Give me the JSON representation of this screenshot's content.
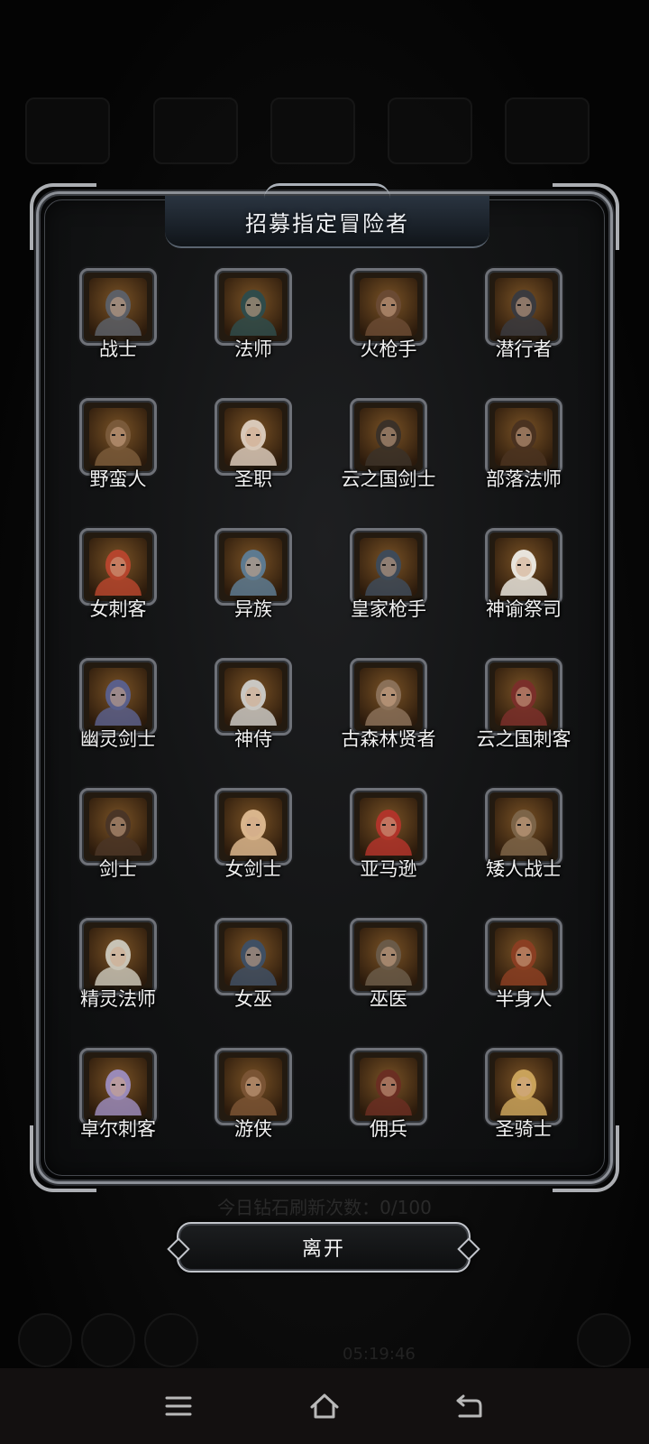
{
  "dialog": {
    "title": "招募指定冒险者",
    "close_label": "离开"
  },
  "background": {
    "refresh_text": "今日钻石刷新次数：0/100",
    "timer_text": "05:19:46"
  },
  "adventurers": [
    {
      "name": "战士",
      "icon": "helmet-knight-icon",
      "tone": "#5c5f66"
    },
    {
      "name": "法师",
      "icon": "hooded-mage-icon",
      "tone": "#2f4b4a"
    },
    {
      "name": "火枪手",
      "icon": "musketeer-icon",
      "tone": "#6a4a33"
    },
    {
      "name": "潜行者",
      "icon": "masked-rogue-icon",
      "tone": "#3a3a3e"
    },
    {
      "name": "野蛮人",
      "icon": "barbarian-icon",
      "tone": "#7a5a3a"
    },
    {
      "name": "圣职",
      "icon": "nun-icon",
      "tone": "#d8c8b8"
    },
    {
      "name": "云之国剑士",
      "icon": "straw-hat-swordsman-icon",
      "tone": "#3b3128"
    },
    {
      "name": "部落法师",
      "icon": "tribal-mage-icon",
      "tone": "#4a3220"
    },
    {
      "name": "女刺客",
      "icon": "female-assassin-icon",
      "tone": "#b5452d"
    },
    {
      "name": "异族",
      "icon": "demon-beast-icon",
      "tone": "#5d7a90"
    },
    {
      "name": "皇家枪手",
      "icon": "royal-gunner-icon",
      "tone": "#3e4a58"
    },
    {
      "name": "神谕祭司",
      "icon": "oracle-priestess-icon",
      "tone": "#e8e4dc"
    },
    {
      "name": "幽灵剑士",
      "icon": "ghost-swordsman-icon",
      "tone": "#5a5f8a"
    },
    {
      "name": "神侍",
      "icon": "white-haired-squire-icon",
      "tone": "#c9c7c2"
    },
    {
      "name": "古森林贤者",
      "icon": "forest-sage-icon",
      "tone": "#8a7058"
    },
    {
      "name": "云之国刺客",
      "icon": "hat-assassin-icon",
      "tone": "#7a2f2a"
    },
    {
      "name": "剑士",
      "icon": "bearded-swordsman-icon",
      "tone": "#4a3526"
    },
    {
      "name": "女剑士",
      "icon": "blonde-swordswoman-icon",
      "tone": "#d9b58c"
    },
    {
      "name": "亚马逊",
      "icon": "amazon-warrior-icon",
      "tone": "#b0342a"
    },
    {
      "name": "矮人战士",
      "icon": "dwarf-warrior-icon",
      "tone": "#7c6448"
    },
    {
      "name": "精灵法师",
      "icon": "elf-mage-icon",
      "tone": "#c8c3b5"
    },
    {
      "name": "女巫",
      "icon": "witch-icon",
      "tone": "#3f4f63"
    },
    {
      "name": "巫医",
      "icon": "skull-mask-shaman-icon",
      "tone": "#6a5a48"
    },
    {
      "name": "半身人",
      "icon": "halfling-icon",
      "tone": "#8a3e22"
    },
    {
      "name": "卓尔刺客",
      "icon": "drow-assassin-icon",
      "tone": "#9a8ab8"
    },
    {
      "name": "游侠",
      "icon": "ranger-icon",
      "tone": "#7a5434"
    },
    {
      "name": "佣兵",
      "icon": "mercenary-icon",
      "tone": "#6a2e22"
    },
    {
      "name": "圣骑士",
      "icon": "paladin-icon",
      "tone": "#c9a25a"
    }
  ],
  "nav": {
    "menu_icon": "menu-icon",
    "home_icon": "home-icon",
    "back_icon": "back-icon"
  }
}
